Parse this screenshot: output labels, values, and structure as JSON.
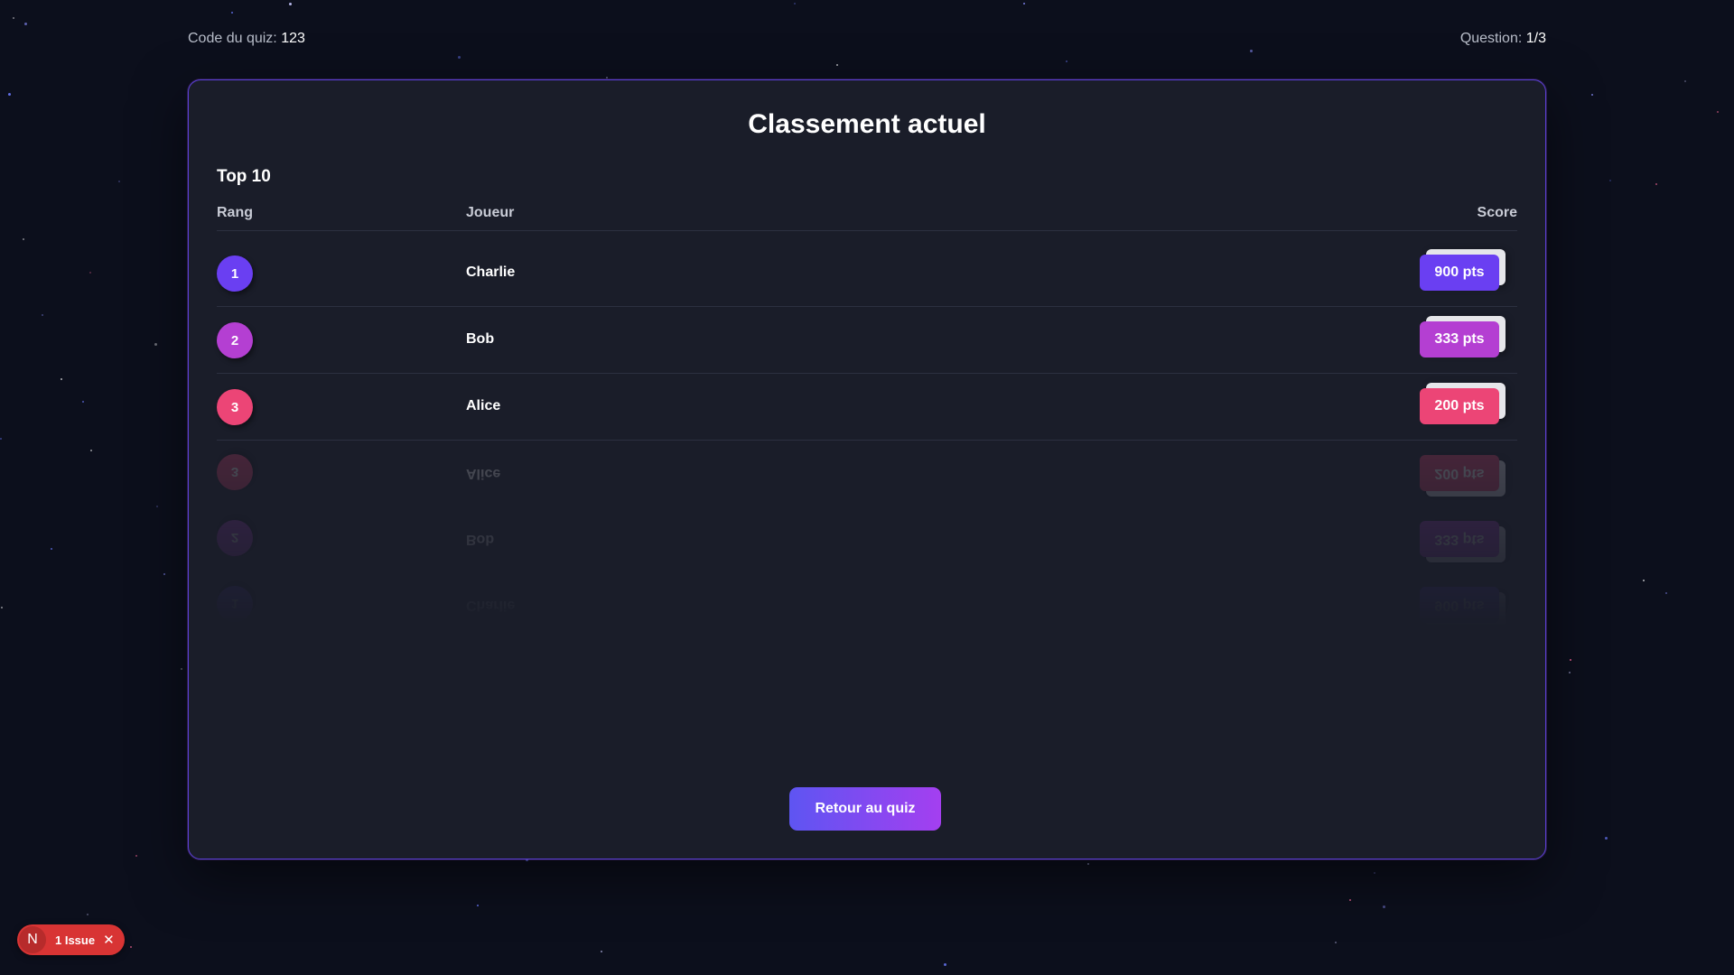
{
  "header": {
    "quiz_code_label": "Code du quiz:",
    "quiz_code_value": "123",
    "question_label": "Question:",
    "question_value": "1/3"
  },
  "leaderboard": {
    "title": "Classement actuel",
    "subtitle": "Top 10",
    "columns": {
      "rank": "Rang",
      "player": "Joueur",
      "score": "Score"
    },
    "rows": [
      {
        "rank": "1",
        "player": "Charlie",
        "score": "900 pts",
        "color": "#6a3ff2"
      },
      {
        "rank": "2",
        "player": "Bob",
        "score": "333 pts",
        "color": "#b43fd2"
      },
      {
        "rank": "3",
        "player": "Alice",
        "score": "200 pts",
        "color": "#ec4576"
      }
    ]
  },
  "actions": {
    "back_label": "Retour au quiz"
  },
  "dev_badge": {
    "logo": "N",
    "issues": "1 Issue",
    "close": "✕"
  },
  "colors": {
    "background": "#0c0f1c",
    "card": "#1a1d29",
    "accent_start": "#5e55f2",
    "accent_end": "#a43ff0",
    "badge": "#d83434"
  }
}
